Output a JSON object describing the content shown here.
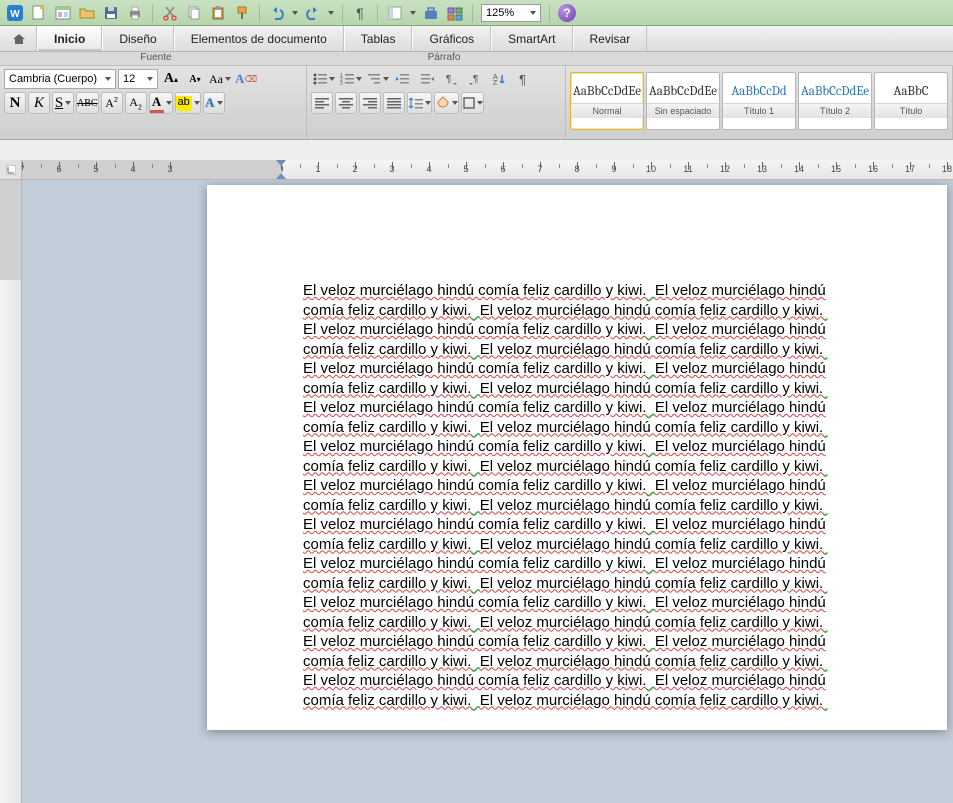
{
  "qat": {
    "zoom": "125%"
  },
  "tabs": [
    "Inicio",
    "Diseño",
    "Elementos de documento",
    "Tablas",
    "Gráficos",
    "SmartArt",
    "Revisar"
  ],
  "activeTab": 0,
  "ribbon": {
    "groupFont": "Fuente",
    "groupPara": "Párrafo",
    "fontName": "Cambria (Cuerpo)",
    "fontSize": "12",
    "bold": "N",
    "italic": "K",
    "underline": "S",
    "strike": "ABC",
    "sup": "A²",
    "sub": "A₂",
    "fontColorLetter": "A",
    "highlightLetter": "abc",
    "clearLetter": "Aa",
    "caseLetter": "A"
  },
  "styles": [
    {
      "preview": "AaBbCcDdEe",
      "label": "Normal",
      "blue": false,
      "sel": true
    },
    {
      "preview": "AaBbCcDdEe",
      "label": "Sin espaciado",
      "blue": false,
      "sel": false
    },
    {
      "preview": "AaBbCcDd",
      "label": "Título 1",
      "blue": true,
      "sel": false
    },
    {
      "preview": "AaBbCcDdEe",
      "label": "Título 2",
      "blue": true,
      "sel": false
    },
    {
      "preview": "AaBbC",
      "label": "Título",
      "blue": false,
      "sel": false
    }
  ],
  "document": {
    "sentence": "El veloz murciélago hindú comía feliz cardillo y kiwi.",
    "repeat": 33
  }
}
